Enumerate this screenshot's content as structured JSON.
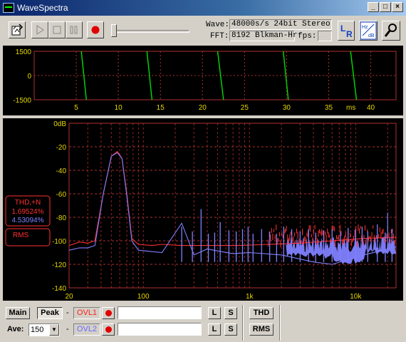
{
  "window": {
    "title": "WaveSpectra",
    "minimize": "_",
    "maximize": "□",
    "close": "×"
  },
  "toolbar": {
    "wave_label": "Wave:",
    "wave_value": "48000s/s 24bit Stereo",
    "fft_label": "FFT:",
    "fft_value": "8192 Blkman-Hr",
    "fps_label": "fps:",
    "fps_value": "",
    "lr_button": "L R",
    "hz_db_button": "Hz dB"
  },
  "waveform": {
    "y_ticks": [
      "1500",
      "0",
      "-1500"
    ],
    "x_ticks": [
      "5",
      "10",
      "15",
      "20",
      "25",
      "30",
      "35",
      "40"
    ],
    "x_unit": "ms"
  },
  "spectrum": {
    "y_ticks": [
      "0dB",
      "-20",
      "-40",
      "-60",
      "-80",
      "-100",
      "-120",
      "-140"
    ],
    "x_ticks": [
      "20",
      "100",
      "1k",
      "10k"
    ]
  },
  "thd_box": {
    "label": "THD,+N",
    "left": "1.69524%",
    "right": "4.53094%"
  },
  "rms_box": {
    "label": "RMS"
  },
  "bottom": {
    "main_button": "Main",
    "peak_button": "Peak",
    "ave_label": "Ave:",
    "ave_value": "150",
    "dash": "-",
    "ovl1": "OVL1",
    "ovl2": "OVL2",
    "l_button": "L",
    "s_button": "S",
    "thd_button": "THD",
    "rms_button": "RMS"
  },
  "colors": {
    "ch1": "#ff3030",
    "ch2": "#8080ff",
    "wave": "#00dd00",
    "grid": "#b03030",
    "tick": "#e8d800"
  },
  "chart_data": [
    {
      "type": "line",
      "series": [
        {
          "values": [
            [
              6.2,
              -1600
            ],
            [
              5.6,
              1500
            ],
            [
              14.0,
              -1600
            ],
            [
              13.4,
              1500
            ],
            [
              22.5,
              -1600
            ],
            [
              21.8,
              1500
            ],
            [
              30.2,
              -1600
            ],
            [
              29.6,
              1500
            ],
            [
              38.3,
              -1600
            ],
            [
              37.6,
              1500
            ]
          ]
        }
      ],
      "x_ticks": [
        5,
        10,
        15,
        20,
        25,
        30,
        35,
        40
      ],
      "y_ticks": [
        1500,
        0,
        -1500
      ],
      "xlim": [
        0,
        43
      ],
      "ylim": [
        -1500,
        1500
      ],
      "xlabel": "ms"
    },
    {
      "type": "line",
      "x_scale": "log",
      "xlim": [
        20,
        24000
      ],
      "ylim": [
        -140,
        0
      ],
      "x_ticks": [
        "20",
        "100",
        "1k",
        "10k"
      ],
      "y_ticks": [
        0,
        -20,
        -40,
        -60,
        -80,
        -100,
        -120,
        -140
      ],
      "series": [
        {
          "values": [
            [
              20,
              -104
            ],
            [
              25,
              -101
            ],
            [
              30,
              -102
            ],
            [
              35,
              -100
            ],
            [
              42,
              -60
            ],
            [
              50,
              -28
            ],
            [
              57,
              -24
            ],
            [
              63,
              -30
            ],
            [
              70,
              -60
            ],
            [
              78,
              -98
            ],
            [
              90,
              -103
            ],
            [
              120,
              -104
            ],
            [
              150,
              -103
            ],
            [
              230,
              -104
            ],
            [
              400,
              -104
            ],
            [
              800,
              -104
            ],
            [
              1500,
              -103
            ],
            [
              3000,
              -102
            ],
            [
              6000,
              -100
            ],
            [
              12000,
              -98
            ],
            [
              24000,
              -97
            ]
          ]
        },
        {
          "values": [
            [
              20,
              -108
            ],
            [
              25,
              -106
            ],
            [
              30,
              -106
            ],
            [
              35,
              -104
            ],
            [
              42,
              -60
            ],
            [
              50,
              -28
            ],
            [
              57,
              -25
            ],
            [
              63,
              -30
            ],
            [
              70,
              -62
            ],
            [
              78,
              -100
            ],
            [
              90,
              -108
            ],
            [
              150,
              -110
            ],
            [
              230,
              -85
            ],
            [
              300,
              -112
            ],
            [
              400,
              -107
            ],
            [
              700,
              -111
            ],
            [
              1000,
              -110
            ],
            [
              2000,
              -112
            ],
            [
              4000,
              -118
            ],
            [
              6000,
              -120
            ],
            [
              12000,
              -112
            ],
            [
              24000,
              -105
            ]
          ]
        }
      ]
    }
  ]
}
